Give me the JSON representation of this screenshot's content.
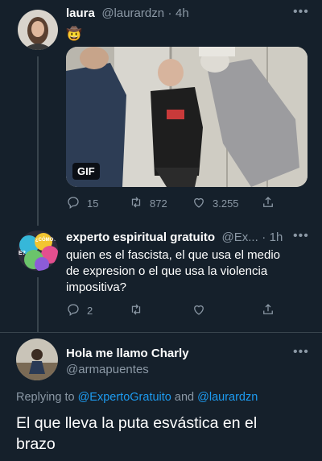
{
  "tweet1": {
    "name": "laura",
    "handle": "@laurardzn",
    "sep": "·",
    "time": "4h",
    "emoji": "🤠",
    "media_badge": "GIF",
    "reply_count": "15",
    "retweet_count": "872",
    "like_count": "3.255"
  },
  "tweet2": {
    "name": "experto espiritual gratuito",
    "handle": "@Ex...",
    "sep": "·",
    "time": "1h",
    "avatar_text_1": "¿CÓMO?",
    "avatar_text_2": "E?",
    "line1": "quien es el fascista, el que usa el medio",
    "line2": "de expresion o el que usa la violencia",
    "line3": "impositiva?",
    "reply_count": "2"
  },
  "tweet3": {
    "name": "Hola me llamo Charly",
    "handle": "@armapuentes",
    "replying_prefix": "Replying to",
    "replying_user1": "@ExpertoGratuito",
    "replying_and": "and",
    "replying_user2": "@laurardzn",
    "line1": "El que lleva la puta esvástica en el",
    "line2": "brazo"
  },
  "colors": {
    "background": "#15202b",
    "muted": "#8b98a5",
    "link": "#1d9bf0",
    "divider": "#38444d"
  }
}
